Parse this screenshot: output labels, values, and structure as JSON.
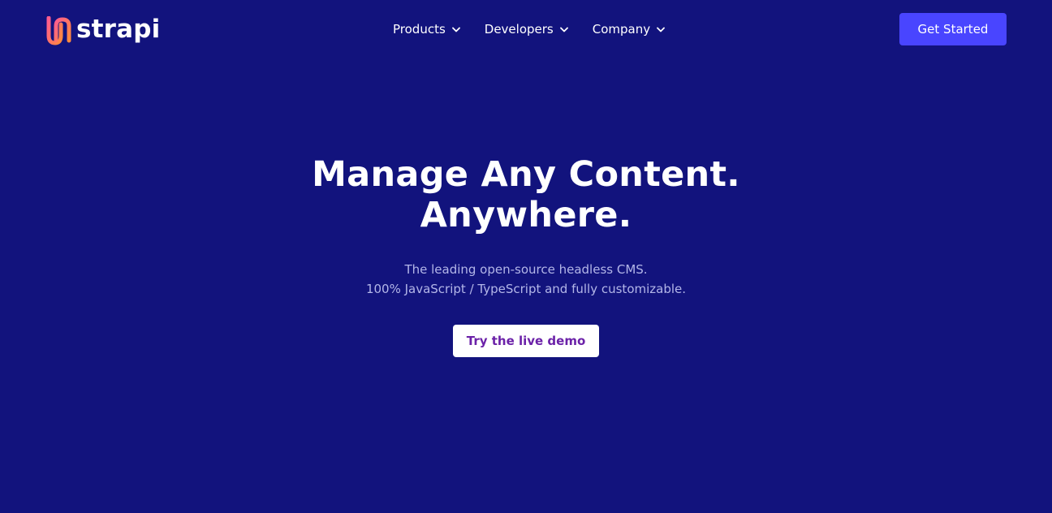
{
  "brand": {
    "name": "strapi",
    "logo_icon": "strapi-logo-icon",
    "logo_gradient": [
      "#ff5d8f",
      "#ff8a3d"
    ]
  },
  "nav": {
    "items": [
      {
        "label": "Products",
        "icon": "chevron-down-icon"
      },
      {
        "label": "Developers",
        "icon": "chevron-down-icon"
      },
      {
        "label": "Company",
        "icon": "chevron-down-icon"
      }
    ]
  },
  "header": {
    "get_started_label": "Get Started"
  },
  "hero": {
    "title_line1": "Manage Any Content.",
    "title_line2": "Anywhere.",
    "subtitle_line1": "The leading open-source headless CMS.",
    "subtitle_line2": "100% JavaScript / TypeScript and fully customizable.",
    "demo_button_label": "Try the live demo"
  },
  "colors": {
    "background": "#12137d",
    "primary_button": "#4945ff",
    "demo_button_text": "#6b21a8",
    "subtitle_text": "#b3b6e8"
  }
}
